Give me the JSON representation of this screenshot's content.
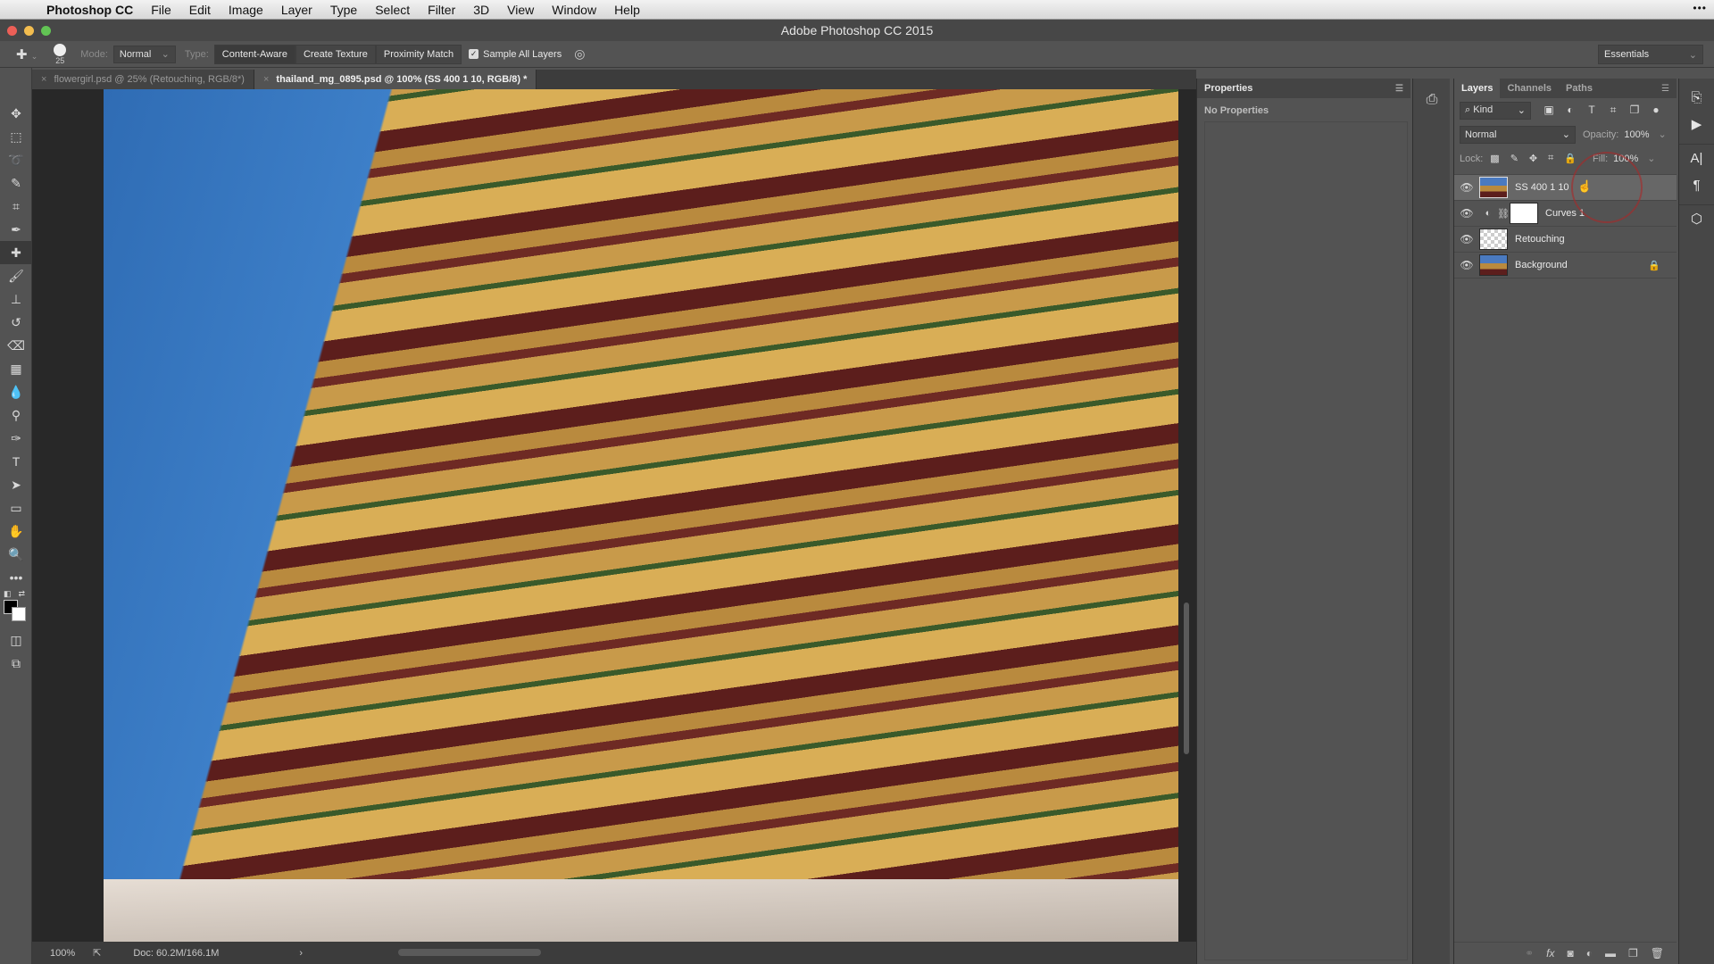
{
  "menubar": {
    "app_name": "Photoshop CC",
    "items": [
      "File",
      "Edit",
      "Image",
      "Layer",
      "Type",
      "Select",
      "Filter",
      "3D",
      "View",
      "Window",
      "Help"
    ]
  },
  "window": {
    "title": "Adobe Photoshop CC 2015"
  },
  "options": {
    "brush_size": "25",
    "mode_label": "Mode:",
    "mode_value": "Normal",
    "type_label": "Type:",
    "type_buttons": [
      "Content-Aware",
      "Create Texture",
      "Proximity Match"
    ],
    "sample_all_layers_label": "Sample All Layers",
    "sample_all_layers_checked": true,
    "workspace": "Essentials"
  },
  "toolbar": {
    "tools": [
      {
        "name": "move-tool",
        "glyph": "✥"
      },
      {
        "name": "marquee-tool",
        "glyph": "⬚"
      },
      {
        "name": "lasso-tool",
        "glyph": "➰"
      },
      {
        "name": "quick-selection-tool",
        "glyph": "✎"
      },
      {
        "name": "crop-tool",
        "glyph": "⌗"
      },
      {
        "name": "eyedropper-tool",
        "glyph": "✒"
      },
      {
        "name": "healing-brush-tool",
        "glyph": "✚",
        "active": true
      },
      {
        "name": "brush-tool",
        "glyph": "🖌"
      },
      {
        "name": "clone-stamp-tool",
        "glyph": "⊥"
      },
      {
        "name": "history-brush-tool",
        "glyph": "↺"
      },
      {
        "name": "eraser-tool",
        "glyph": "⌫"
      },
      {
        "name": "gradient-tool",
        "glyph": "▦"
      },
      {
        "name": "blur-tool",
        "glyph": "💧"
      },
      {
        "name": "dodge-tool",
        "glyph": "⚲"
      },
      {
        "name": "pen-tool",
        "glyph": "✑"
      },
      {
        "name": "type-tool",
        "glyph": "T"
      },
      {
        "name": "path-selection-tool",
        "glyph": "➤"
      },
      {
        "name": "rectangle-tool",
        "glyph": "▭"
      },
      {
        "name": "hand-tool",
        "glyph": "✋"
      },
      {
        "name": "zoom-tool",
        "glyph": "🔍"
      },
      {
        "name": "more-tools",
        "glyph": "•••"
      }
    ],
    "extra": [
      {
        "name": "quick-mask-mode",
        "glyph": "◫"
      },
      {
        "name": "screen-mode",
        "glyph": "⧉"
      }
    ]
  },
  "documents": {
    "tabs": [
      {
        "label": "flowergirl.psd @ 25% (Retouching, RGB/8*)",
        "active": false
      },
      {
        "label": "thailand_mg_0895.psd @ 100% (SS 400 1 10, RGB/8) *",
        "active": true
      }
    ]
  },
  "status": {
    "zoom": "100%",
    "doc_info": "Doc: 60.2M/166.1M",
    "arrow": "›"
  },
  "properties": {
    "title": "Properties",
    "empty_text": "No Properties"
  },
  "layers_panel": {
    "tabs": [
      "Layers",
      "Channels",
      "Paths"
    ],
    "filter_kind": "Kind",
    "blend_mode": "Normal",
    "opacity_label": "Opacity:",
    "opacity": "100%",
    "lock_label": "Lock:",
    "fill_label": "Fill:",
    "fill": "100%",
    "layers": [
      {
        "name": "SS 400 1 10",
        "thumb": "photo",
        "selected": true,
        "visible": true
      },
      {
        "name": "Curves 1",
        "thumb": "white",
        "adjustment": true,
        "visible": true
      },
      {
        "name": "Retouching",
        "thumb": "trans",
        "visible": true
      },
      {
        "name": "Background",
        "thumb": "photo",
        "locked": true,
        "visible": true
      }
    ],
    "footer_icons": [
      "link-layers-icon",
      "fx-icon",
      "add-mask-icon",
      "adjustment-layer-icon",
      "group-folder-icon",
      "new-layer-icon",
      "trash-icon"
    ]
  }
}
